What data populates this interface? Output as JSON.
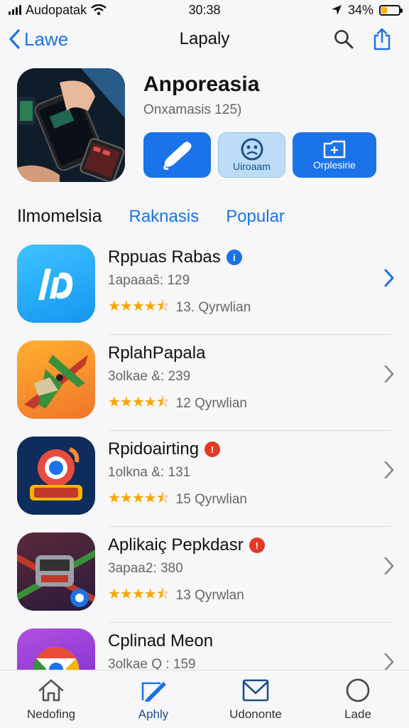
{
  "status_bar": {
    "carrier": "Audopatak",
    "time": "30:38",
    "battery": "34%",
    "battery_level": 0.34
  },
  "nav": {
    "back_label": "Lawe",
    "title": "Lapaly"
  },
  "hero": {
    "title": "Anporeasia",
    "subtitle": "Onxamasis 125)",
    "actions": [
      {
        "label": "",
        "icon": "brush-icon"
      },
      {
        "label": "Uiroaam",
        "icon": "face-icon"
      },
      {
        "label": "Orplesirie",
        "icon": "folder-icon"
      }
    ]
  },
  "tabs": [
    {
      "label": "Ilmomelsia",
      "active": true
    },
    {
      "label": "Raknasis",
      "active": false
    },
    {
      "label": "Popular",
      "active": false
    }
  ],
  "apps": [
    {
      "name": "Rppuas Rabas",
      "badge": "i",
      "badge_color": "blue",
      "meta": "1apaaaŝ: 129",
      "rating": 4.5,
      "reviews": "13. Qyrwlian",
      "icon": "logo-blue-icon",
      "chevron_color": "#1a73e8"
    },
    {
      "name": "RplahPapala",
      "badge": "",
      "badge_color": "",
      "meta": "3olkae &: 239",
      "rating": 4.5,
      "reviews": "12 Qyrwlian",
      "icon": "plane-icon",
      "chevron_color": "#888888"
    },
    {
      "name": "Rpidoairting",
      "badge": "!",
      "badge_color": "red",
      "meta": "1olkna &: 131",
      "rating": 4.5,
      "reviews": "15  Qyrwlian",
      "icon": "browser-badge-icon",
      "chevron_color": "#888888"
    },
    {
      "name": "Aplikaiç Pepkdasr",
      "badge": "!",
      "badge_color": "red",
      "meta": "3apaa2: 380",
      "rating": 4.5,
      "reviews": "13 Qyrwlan",
      "icon": "robot-icon",
      "chevron_color": "#888888"
    },
    {
      "name": "Cplinad Meon",
      "badge": "",
      "badge_color": "",
      "meta": "3olkae Q : 159",
      "rating": 0,
      "reviews": "",
      "icon": "chrome-icon",
      "chevron_color": "#888888"
    }
  ],
  "tab_bar": [
    {
      "label": "Nedofing",
      "icon": "home-icon",
      "active": false
    },
    {
      "label": "Aphly",
      "icon": "pencil-icon",
      "active": true
    },
    {
      "label": "Udononte",
      "icon": "mail-icon",
      "active": false
    },
    {
      "label": "Lade",
      "icon": "circle-icon",
      "active": false
    }
  ]
}
